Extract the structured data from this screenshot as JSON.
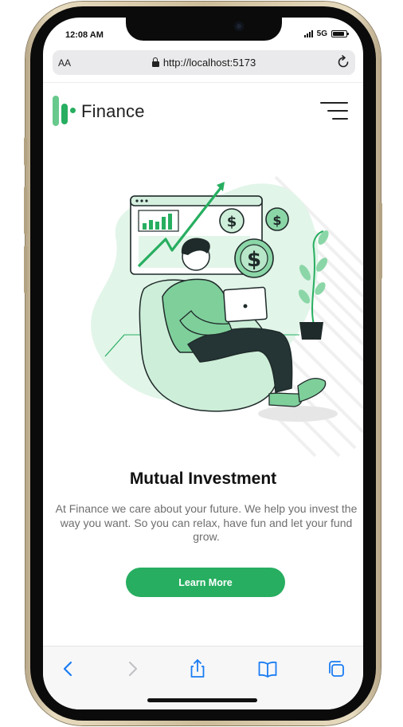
{
  "status_bar": {
    "time": "12:08 AM",
    "network": "5G"
  },
  "browser": {
    "text_size_label": "AA",
    "url": "http://localhost:5173"
  },
  "header": {
    "logo_text": "Finance"
  },
  "hero": {
    "title": "Mutual Investment",
    "description": "At Finance we care about your future. We help you invest the way you want. So you can relax, have fun and let your fund grow.",
    "cta_label": "Learn More"
  },
  "colors": {
    "brand_green": "#27ae60",
    "brand_green_light": "#68c98c",
    "safari_blue": "#1a7cf2"
  },
  "icons": [
    "search-icon",
    "lock-icon",
    "reload-icon",
    "menu-icon",
    "back-icon",
    "forward-icon",
    "share-icon",
    "bookmarks-icon",
    "tabs-icon"
  ]
}
